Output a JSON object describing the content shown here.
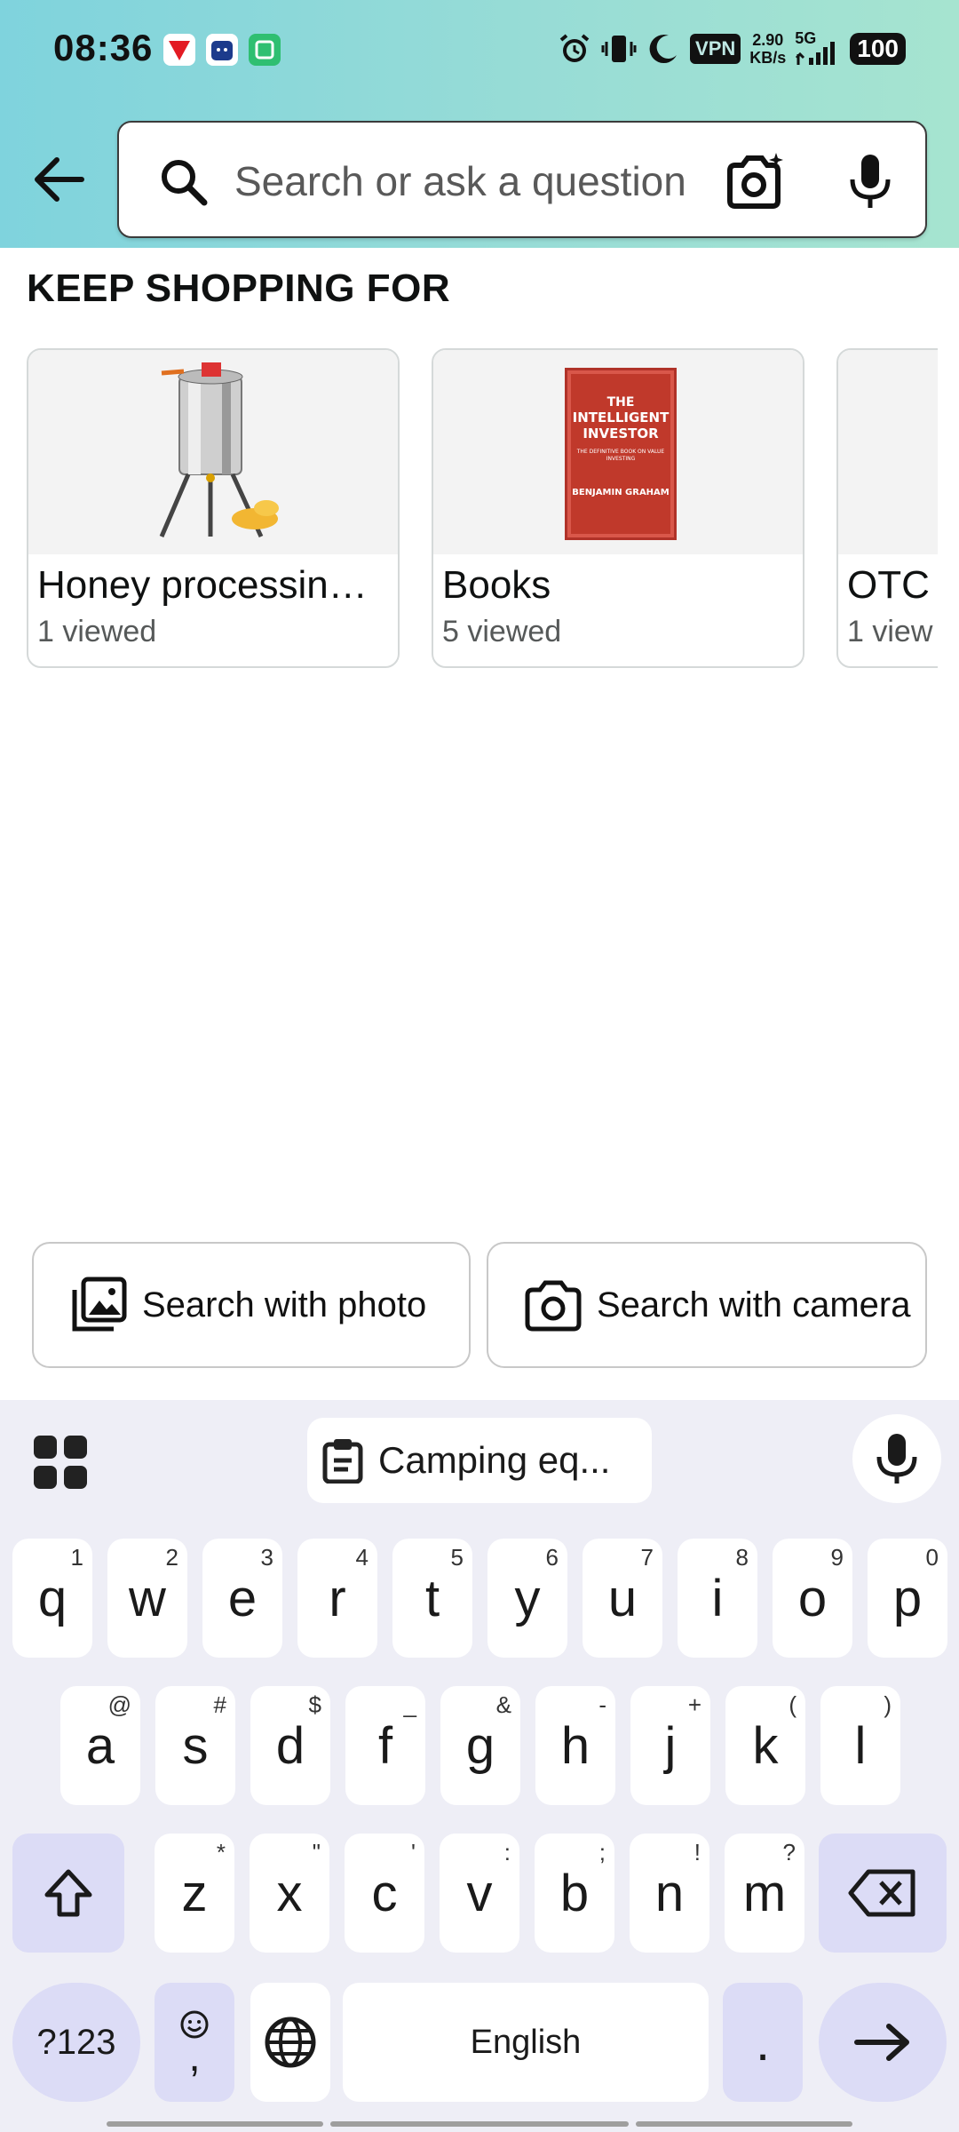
{
  "status_bar": {
    "time": "08:36",
    "vpn": "VPN",
    "speed_value": "2.90",
    "speed_unit": "KB/s",
    "network": "5G",
    "battery": "100"
  },
  "search": {
    "placeholder": "Search or ask a question"
  },
  "keep_shopping": {
    "heading": "KEEP SHOPPING FOR",
    "cards": [
      {
        "title": "Honey processin…",
        "subtitle": "1 viewed"
      },
      {
        "title": "Books",
        "subtitle": "5 viewed",
        "book": {
          "title_line1": "THE",
          "title_line2": "INTELLIGENT",
          "title_line3": "INVESTOR",
          "tagline": "THE DEFINITIVE BOOK ON VALUE INVESTING",
          "author": "BENJAMIN GRAHAM"
        }
      },
      {
        "title": "OTC r",
        "subtitle": "1 view"
      }
    ]
  },
  "photo_buttons": {
    "photo": "Search with photo",
    "camera": "Search with camera"
  },
  "keyboard": {
    "clipboard_chip": "Camping eq...",
    "row1": [
      {
        "k": "q",
        "s": "1"
      },
      {
        "k": "w",
        "s": "2"
      },
      {
        "k": "e",
        "s": "3"
      },
      {
        "k": "r",
        "s": "4"
      },
      {
        "k": "t",
        "s": "5"
      },
      {
        "k": "y",
        "s": "6"
      },
      {
        "k": "u",
        "s": "7"
      },
      {
        "k": "i",
        "s": "8"
      },
      {
        "k": "o",
        "s": "9"
      },
      {
        "k": "p",
        "s": "0"
      }
    ],
    "row2": [
      {
        "k": "a",
        "s": "@"
      },
      {
        "k": "s",
        "s": "#"
      },
      {
        "k": "d",
        "s": "$"
      },
      {
        "k": "f",
        "s": "_"
      },
      {
        "k": "g",
        "s": "&"
      },
      {
        "k": "h",
        "s": "-"
      },
      {
        "k": "j",
        "s": "+"
      },
      {
        "k": "k",
        "s": "("
      },
      {
        "k": "l",
        "s": ")"
      }
    ],
    "row3": [
      {
        "k": "z",
        "s": "*"
      },
      {
        "k": "x",
        "s": "\""
      },
      {
        "k": "c",
        "s": "'"
      },
      {
        "k": "v",
        "s": ":"
      },
      {
        "k": "b",
        "s": ";"
      },
      {
        "k": "n",
        "s": "!"
      },
      {
        "k": "m",
        "s": "?"
      }
    ],
    "symbols_key": "?123",
    "comma_key": ",",
    "space_label": "English",
    "period_key": "."
  }
}
